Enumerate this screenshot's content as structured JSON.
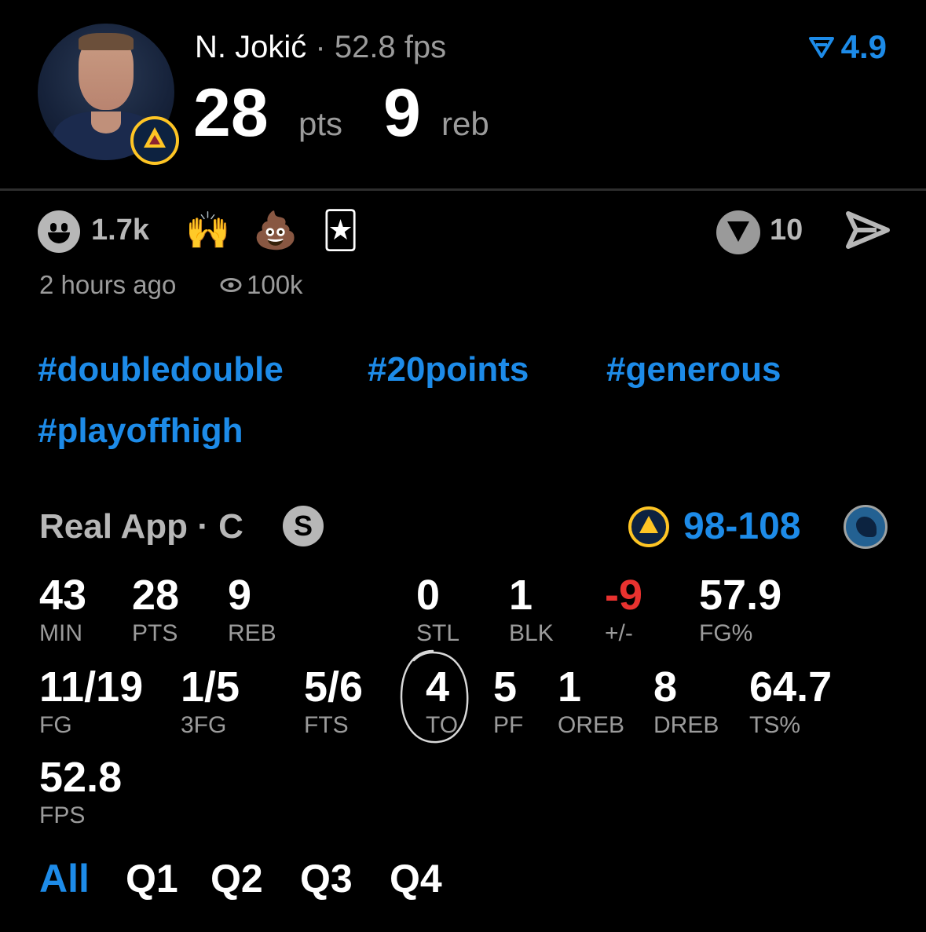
{
  "player": {
    "name": "N. Jokić",
    "separator": "·",
    "fps_label": "52.8 fps",
    "points": "28",
    "points_unit": "pts",
    "rebounds": "9",
    "rebounds_unit": "reb",
    "rating": "4.9"
  },
  "reactions": {
    "count": "1.7k",
    "emojis": [
      "🙌",
      "💩",
      "🃏"
    ],
    "votes": "10",
    "time_ago": "2 hours ago",
    "views": "100k"
  },
  "hashtags": [
    "#doubledouble",
    "#20points",
    "#generous",
    "#playoffhigh"
  ],
  "game": {
    "source": "Real App · C",
    "badge": "S",
    "score": "98-108"
  },
  "stats_row1": [
    {
      "value": "43",
      "label": "MIN"
    },
    {
      "value": "28",
      "label": "PTS"
    },
    {
      "value": "9",
      "label": "REB"
    },
    {
      "value": "0",
      "label": "STL"
    },
    {
      "value": "1",
      "label": "BLK"
    },
    {
      "value": "-9",
      "label": "+/-"
    },
    {
      "value": "57.9",
      "label": "FG%"
    }
  ],
  "stats_row2": [
    {
      "value": "11/19",
      "label": "FG"
    },
    {
      "value": "1/5",
      "label": "3FG"
    },
    {
      "value": "5/6",
      "label": "FTS"
    },
    {
      "value": "4",
      "label": "TO"
    },
    {
      "value": "5",
      "label": "PF"
    },
    {
      "value": "1",
      "label": "OREB"
    },
    {
      "value": "8",
      "label": "DREB"
    },
    {
      "value": "64.7",
      "label": "TS%"
    }
  ],
  "stats_row3": [
    {
      "value": "52.8",
      "label": "FPS"
    }
  ],
  "quarters": [
    "All",
    "Q1",
    "Q2",
    "Q3",
    "Q4"
  ],
  "colors": {
    "accent": "#1d8be8",
    "negative": "#e8322f",
    "muted": "#9b9b9b"
  },
  "icons": {
    "avatar": "player-photo",
    "team": "nuggets-logo",
    "opponent": "timberwolves-logo",
    "rating": "v-filter-icon",
    "send": "send-icon",
    "views": "eye-icon",
    "reaction": "smiley-icon"
  }
}
